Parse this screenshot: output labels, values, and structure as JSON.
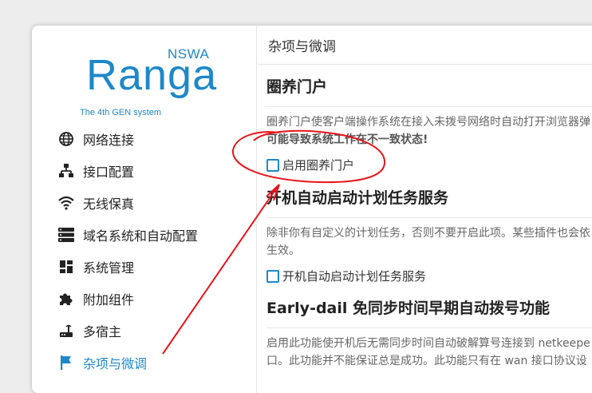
{
  "logo": {
    "brand": "Ranga",
    "superscript": "NSWA",
    "tagline": "The 4th GEN system"
  },
  "sidebar": {
    "items": [
      {
        "label": "网络连接",
        "icon": "globe-icon"
      },
      {
        "label": "接口配置",
        "icon": "network-icon"
      },
      {
        "label": "无线保真",
        "icon": "wifi-icon"
      },
      {
        "label": "域名系统和自动配置",
        "icon": "server-icon"
      },
      {
        "label": "系统管理",
        "icon": "dashboard-icon"
      },
      {
        "label": "附加组件",
        "icon": "puzzle-icon"
      },
      {
        "label": "多宿主",
        "icon": "router-icon"
      },
      {
        "label": "杂项与微调",
        "icon": "flag-icon",
        "active": true
      }
    ]
  },
  "page": {
    "title": "杂项与微调"
  },
  "sections": {
    "captive": {
      "heading": "圈养门户",
      "desc": "圈养门户使客户端操作系统在接入未拨号网络时自动打开浏览器弹",
      "warning": "可能导致系统工作在不一致状态!",
      "checkbox_label": "启用圈养门户"
    },
    "cron": {
      "heading": "开机自动启动计划任务服务",
      "desc_line1": "除非你有自定义的计划任务，否则不要开启此项。某些插件也会依",
      "desc_line2": "生效。",
      "checkbox_label": "开机自动启动计划任务服务"
    },
    "earlydial": {
      "heading": "Early-dail 免同步时间早期自动拨号功能",
      "desc_line1": "启用此功能使开机后无需同步时间自动破解算号连接到 netkeepe",
      "desc_line2": "口。此功能并不能保证总是成功。此功能只有在 wan 接口协议设"
    }
  },
  "colors": {
    "accent": "#1e88c8",
    "annotation": "#e8121a"
  }
}
